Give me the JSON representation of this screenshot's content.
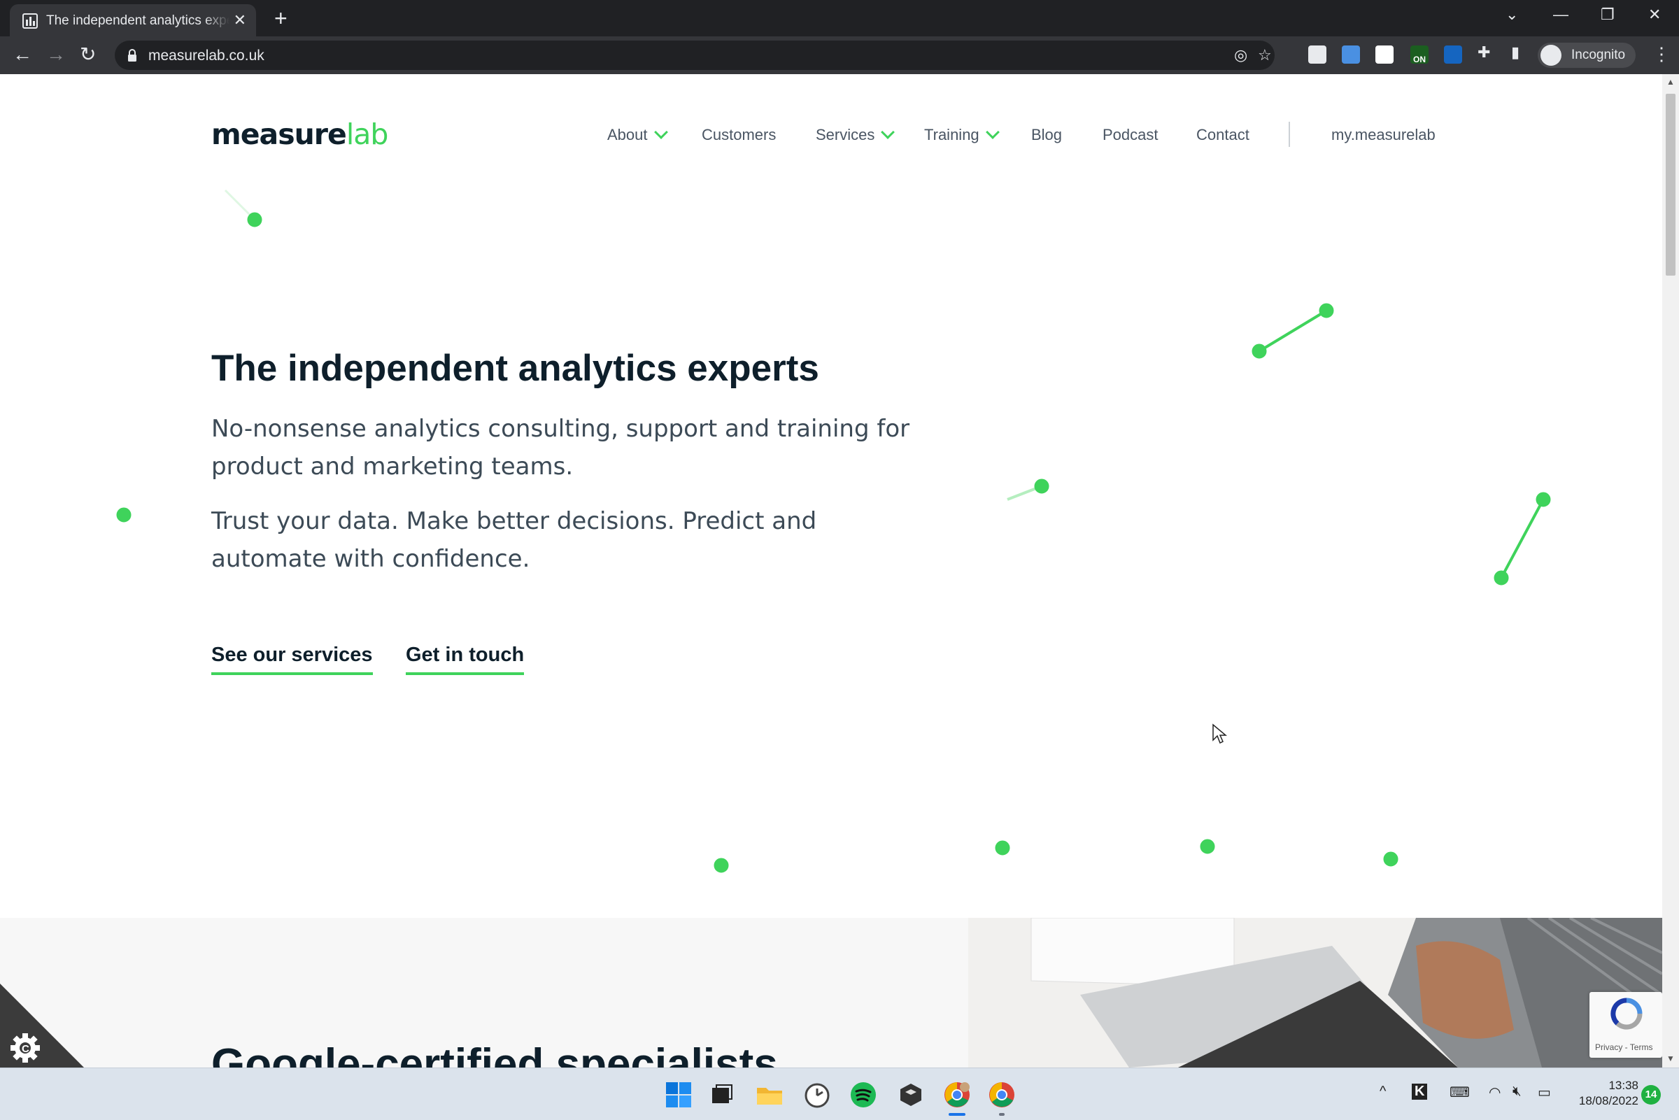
{
  "browser": {
    "tab_title": "The independent analytics experts",
    "tab_close": "✕",
    "new_tab": "+",
    "url": "measurelab.co.uk",
    "profile_label": "Incognito",
    "extension_badge": "ON"
  },
  "site": {
    "logo_measure": "measure",
    "logo_lab": "lab",
    "nav": [
      {
        "label": "About",
        "has_dropdown": true
      },
      {
        "label": "Customers",
        "has_dropdown": false
      },
      {
        "label": "Services",
        "has_dropdown": true
      },
      {
        "label": "Training",
        "has_dropdown": true
      },
      {
        "label": "Blog",
        "has_dropdown": false
      },
      {
        "label": "Podcast",
        "has_dropdown": false
      },
      {
        "label": "Contact",
        "has_dropdown": false
      },
      {
        "label": "my.measurelab",
        "has_dropdown": false
      }
    ],
    "hero_title": "The independent analytics experts",
    "hero_text_1": "No-nonsense analytics consulting, support and training for product and marketing teams.",
    "hero_text_2": "Trust your data. Make better decisions. Predict and automate with confidence.",
    "cta_services": "See our services",
    "cta_contact": "Get in touch",
    "section_title": "Google-certified specialists",
    "recaptcha_links": "Privacy - Terms",
    "accent_color": "#3fd35b",
    "text_color": "#0e1f2b"
  },
  "taskbar": {
    "time": "13:38",
    "date": "18/08/2022",
    "notification_count": "14",
    "apps": [
      "windows-start",
      "task-view",
      "file-explorer",
      "clock-app",
      "spotify",
      "app-box",
      "chrome-profile",
      "chrome"
    ]
  }
}
